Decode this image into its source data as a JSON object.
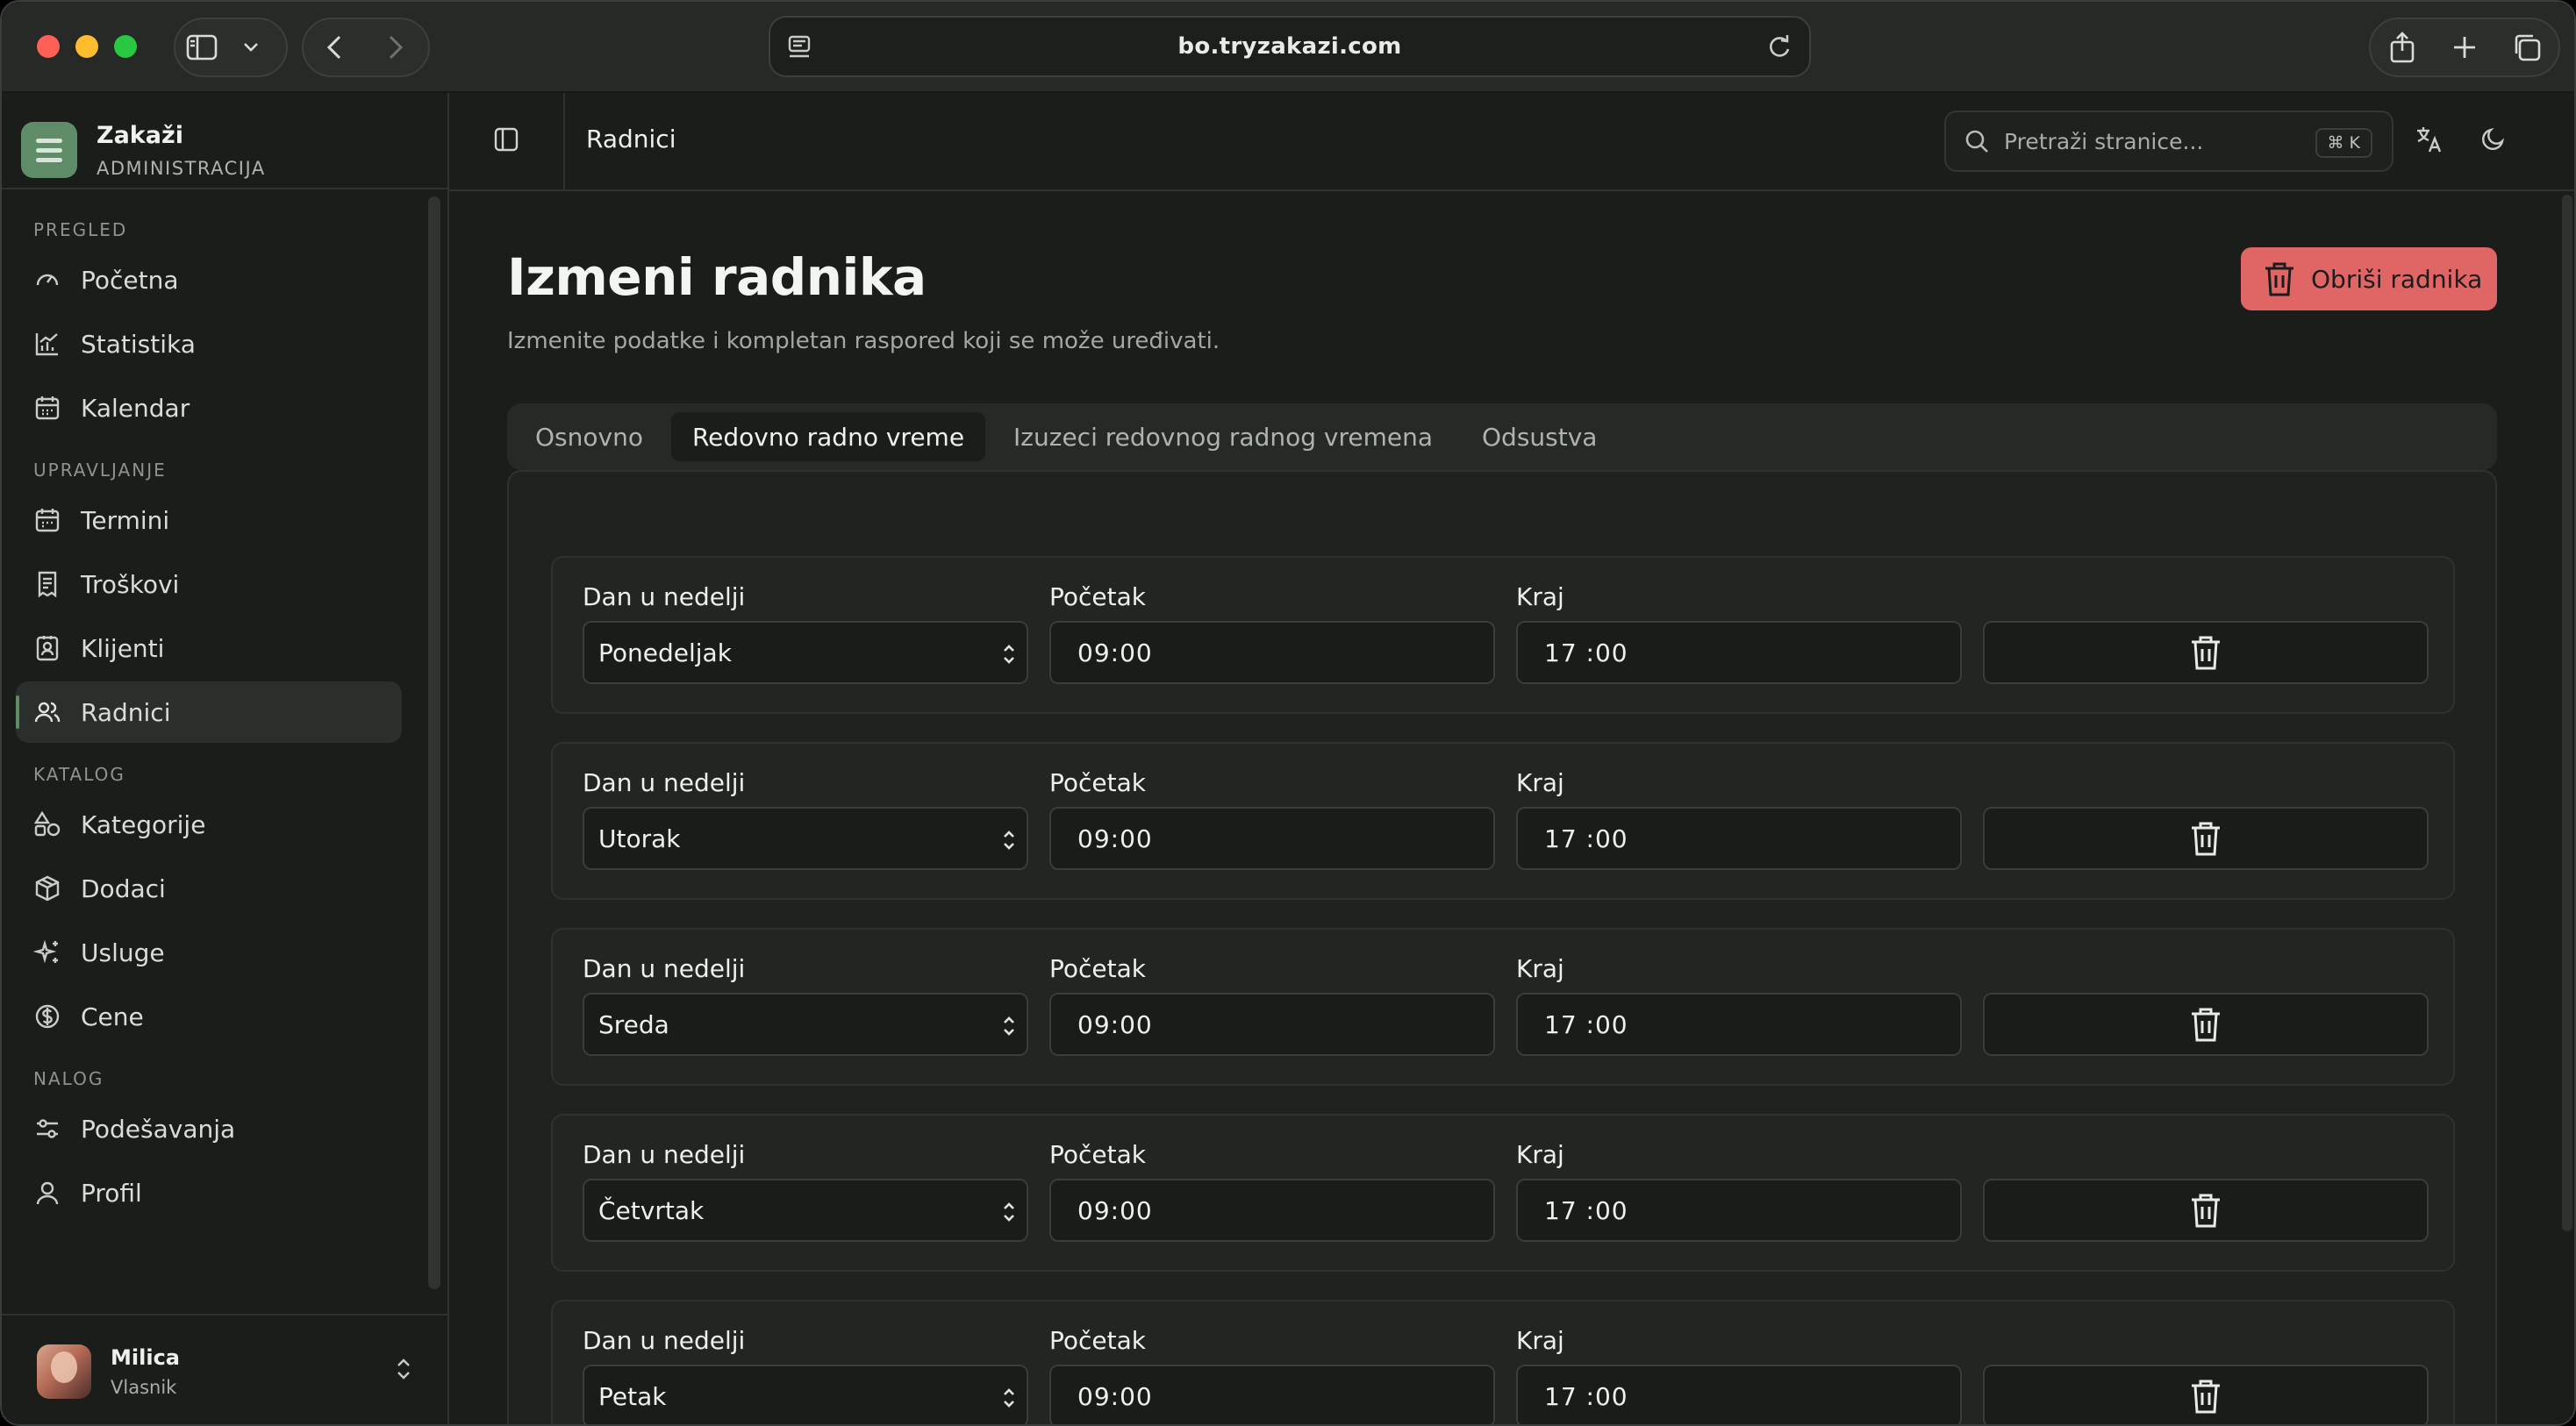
{
  "browser": {
    "url": "bo.tryzakazi.com"
  },
  "brand": {
    "name": "Zakaži",
    "subtitle": "ADMINISTRACIJA"
  },
  "sidebar": {
    "sections": [
      {
        "title": "PREGLED",
        "items": [
          {
            "label": "Početna",
            "icon": "gauge-icon"
          },
          {
            "label": "Statistika",
            "icon": "chart-icon"
          },
          {
            "label": "Kalendar",
            "icon": "calendar-icon"
          }
        ]
      },
      {
        "title": "UPRAVLJANJE",
        "items": [
          {
            "label": "Termini",
            "icon": "calendar-icon"
          },
          {
            "label": "Troškovi",
            "icon": "receipt-icon"
          },
          {
            "label": "Klijenti",
            "icon": "contact-icon"
          },
          {
            "label": "Radnici",
            "icon": "users-icon",
            "active": true
          }
        ]
      },
      {
        "title": "KATALOG",
        "items": [
          {
            "label": "Kategorije",
            "icon": "shapes-icon"
          },
          {
            "label": "Dodaci",
            "icon": "package-icon"
          },
          {
            "label": "Usluge",
            "icon": "sparkles-icon"
          },
          {
            "label": "Cene",
            "icon": "dollar-icon"
          }
        ]
      },
      {
        "title": "NALOG",
        "items": [
          {
            "label": "Podešavanja",
            "icon": "sliders-icon"
          },
          {
            "label": "Profil",
            "icon": "user-icon"
          }
        ]
      }
    ]
  },
  "user": {
    "name": "Milica",
    "role": "Vlasnik"
  },
  "topbar": {
    "title": "Radnici",
    "search_placeholder": "Pretraži stranice...",
    "search_shortcut": "⌘ K"
  },
  "page": {
    "title": "Izmeni radnika",
    "subtitle": "Izmenite podatke i kompletan raspored koji se može uređivati.",
    "delete_label": "Obriši radnika"
  },
  "tabs": [
    {
      "label": "Osnovno",
      "active": false
    },
    {
      "label": "Redovno radno vreme",
      "active": true
    },
    {
      "label": "Izuzeci redovnog radnog vremena",
      "active": false
    },
    {
      "label": "Odsustva",
      "active": false
    }
  ],
  "schedule": {
    "labels": {
      "day": "Dan u nedelji",
      "start": "Početak",
      "end": "Kraj"
    },
    "rows": [
      {
        "day": "Ponedeljak",
        "start": "09:00",
        "end": "17 :00"
      },
      {
        "day": "Utorak",
        "start": "09:00",
        "end": "17 :00"
      },
      {
        "day": "Sreda",
        "start": "09:00",
        "end": "17 :00"
      },
      {
        "day": "Četvrtak",
        "start": "09:00",
        "end": "17 :00"
      },
      {
        "day": "Petak",
        "start": "09:00",
        "end": "17 :00"
      }
    ]
  },
  "colors": {
    "accent": "#5e8d68",
    "danger": "#e06565",
    "background": "#1b1d1b"
  }
}
